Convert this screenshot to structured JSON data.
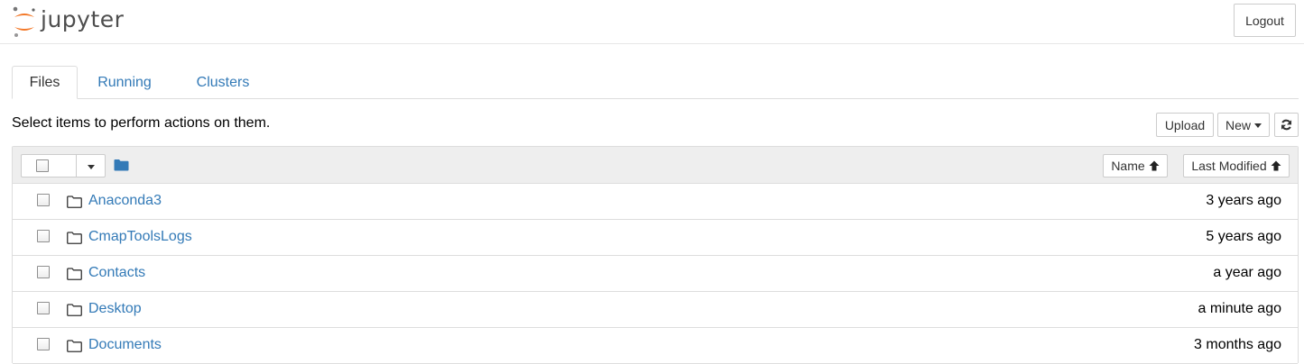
{
  "header": {
    "logo_text": "jupyter",
    "logout_label": "Logout"
  },
  "tabs": [
    {
      "label": "Files",
      "active": true
    },
    {
      "label": "Running",
      "active": false
    },
    {
      "label": "Clusters",
      "active": false
    }
  ],
  "toolbar": {
    "instructions": "Select items to perform actions on them.",
    "upload_label": "Upload",
    "new_label": "New",
    "refresh_icon": "refresh-icon"
  },
  "list_header": {
    "name_sort_label": "Name",
    "modified_sort_label": "Last Modified",
    "sort_icon": "arrow-up-icon",
    "folder_icon": "folder-icon"
  },
  "items": [
    {
      "name": "Anaconda3",
      "modified": "3 years ago",
      "type": "folder"
    },
    {
      "name": "CmapToolsLogs",
      "modified": "5 years ago",
      "type": "folder"
    },
    {
      "name": "Contacts",
      "modified": "a year ago",
      "type": "folder"
    },
    {
      "name": "Desktop",
      "modified": "a minute ago",
      "type": "folder"
    },
    {
      "name": "Documents",
      "modified": "3 months ago",
      "type": "folder"
    }
  ],
  "colors": {
    "link": "#337ab7",
    "logo_orange": "#f37726",
    "logo_gray": "#767677",
    "header_bg": "#eeeeee"
  }
}
